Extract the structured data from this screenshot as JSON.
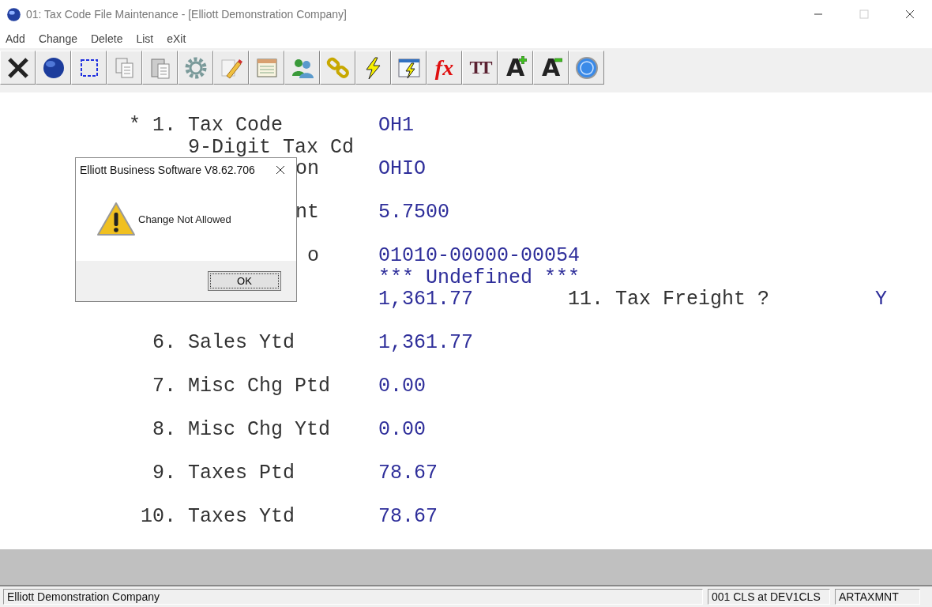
{
  "window": {
    "title": "01:  Tax Code File Maintenance - [Elliott Demonstration Company]"
  },
  "menu": [
    {
      "label": "Add"
    },
    {
      "label": "Change"
    },
    {
      "label": "Delete"
    },
    {
      "label": "List"
    },
    {
      "label": "eXit"
    }
  ],
  "toolbar": [
    {
      "kind": "icon"
    },
    {
      "kind": "icon"
    },
    {
      "kind": "icon"
    },
    {
      "kind": "icon"
    },
    {
      "kind": "icon"
    },
    {
      "kind": "icon"
    },
    {
      "kind": "icon"
    },
    {
      "kind": "icon"
    },
    {
      "kind": "icon"
    },
    {
      "kind": "icon"
    },
    {
      "kind": "icon"
    },
    {
      "kind": "icon"
    },
    {
      "kind": "fx",
      "text": "fx"
    },
    {
      "kind": "tt",
      "text": "TT"
    },
    {
      "kind": "grow",
      "text": "A"
    },
    {
      "kind": "shrink",
      "text": "A"
    },
    {
      "kind": "icon"
    }
  ],
  "fields": [
    {
      "kind": "full",
      "marker": "*",
      "number": "1.",
      "label": "Tax Code",
      "label_2": "9-Digit Tax Cd",
      "value": "OH1"
    },
    {
      "kind": "tail",
      "label": "on",
      "value": "OHIO"
    },
    {
      "kind": "tail",
      "label": "nt",
      "value": "5.7500"
    },
    {
      "kind": "tail",
      "label": "o",
      "value": "01010-00000-00054",
      "value_2": "*** Undefined ***"
    },
    {
      "kind": "full",
      "value": "1,361.77",
      "side": {
        "number": "11.",
        "label": "Tax Freight ?",
        "value": "Y"
      }
    },
    {
      "kind": "full",
      "number": "6.",
      "label": "Sales Ytd",
      "value": "1,361.77"
    },
    {
      "kind": "full",
      "number": "7.",
      "label": "Misc Chg Ptd",
      "value": "0.00"
    },
    {
      "kind": "full",
      "number": "8.",
      "label": "Misc Chg Ytd",
      "value": "0.00"
    },
    {
      "kind": "full",
      "number": "9.",
      "label": "Taxes Ptd",
      "value": "78.67"
    },
    {
      "kind": "full",
      "number": "10.",
      "label": "Taxes Ytd",
      "value": "78.67"
    }
  ],
  "dialog": {
    "title": "Elliott Business Software V8.62.706",
    "message": "Change Not Allowed",
    "button": "OK"
  },
  "status_bar": [
    "Elliott Demonstration Company",
    "001 CLS at DEV1CLS",
    "ARTAXMNT"
  ]
}
